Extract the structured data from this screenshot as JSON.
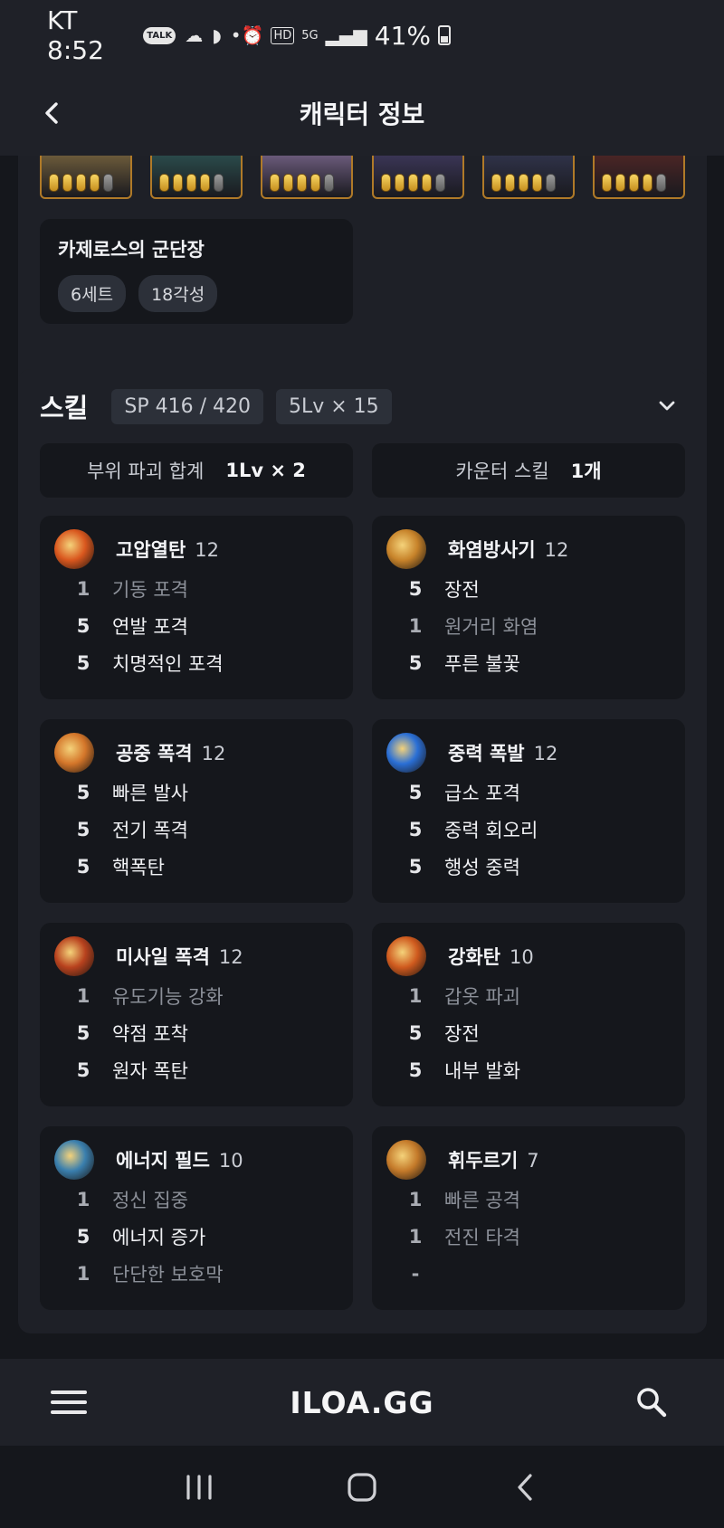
{
  "status_bar": {
    "carrier_time": "KT 8:52",
    "talk_label": "TALK",
    "network": "5G",
    "battery": "41%",
    "hd_label": "HD"
  },
  "header": {
    "title": "캐릭터 정보"
  },
  "engraving_set": {
    "title": "카제로스의 군단장",
    "tags": [
      "6세트",
      "18각성"
    ]
  },
  "portraits": [
    {
      "filled": 4,
      "total": 5,
      "bg": "#6b5a3a"
    },
    {
      "filled": 4,
      "total": 5,
      "bg": "#2a4a4a"
    },
    {
      "filled": 4,
      "total": 5,
      "bg": "#6a5a7a"
    },
    {
      "filled": 4,
      "total": 5,
      "bg": "#3a3555"
    },
    {
      "filled": 4,
      "total": 5,
      "bg": "#2f3248"
    },
    {
      "filled": 4,
      "total": 5,
      "bg": "#4a2525"
    }
  ],
  "skills_section": {
    "title": "스킬",
    "sp": "SP 416 / 420",
    "level_summary": "5Lv × 15",
    "part_break_label": "부위 파괴 합계",
    "part_break_value": "1Lv × 2",
    "counter_label": "카운터 스킬",
    "counter_value": "1개"
  },
  "skills": [
    {
      "name": "고압열탄",
      "level": "12",
      "icon_color": "#d9571e",
      "tripods": [
        {
          "lv": "1",
          "name": "기동 포격",
          "dim": true
        },
        {
          "lv": "5",
          "name": "연발 포격",
          "dim": false
        },
        {
          "lv": "5",
          "name": "치명적인 포격",
          "dim": false
        }
      ]
    },
    {
      "name": "화염방사기",
      "level": "12",
      "icon_color": "#c7832a",
      "tripods": [
        {
          "lv": "5",
          "name": "장전",
          "dim": false
        },
        {
          "lv": "1",
          "name": "원거리 화염",
          "dim": true
        },
        {
          "lv": "5",
          "name": "푸른 불꽃",
          "dim": false
        }
      ]
    },
    {
      "name": "공중 폭격",
      "level": "12",
      "icon_color": "#d4762a",
      "tripods": [
        {
          "lv": "5",
          "name": "빠른 발사",
          "dim": false
        },
        {
          "lv": "5",
          "name": "전기 폭격",
          "dim": false
        },
        {
          "lv": "5",
          "name": "핵폭탄",
          "dim": false
        }
      ]
    },
    {
      "name": "중력 폭발",
      "level": "12",
      "icon_color": "#2a6fd6",
      "tripods": [
        {
          "lv": "5",
          "name": "급소 포격",
          "dim": false
        },
        {
          "lv": "5",
          "name": "중력 회오리",
          "dim": false
        },
        {
          "lv": "5",
          "name": "행성 중력",
          "dim": false
        }
      ]
    },
    {
      "name": "미사일 폭격",
      "level": "12",
      "icon_color": "#b8421e",
      "tripods": [
        {
          "lv": "1",
          "name": "유도기능 강화",
          "dim": true
        },
        {
          "lv": "5",
          "name": "약점 포착",
          "dim": false
        },
        {
          "lv": "5",
          "name": "원자 폭탄",
          "dim": false
        }
      ]
    },
    {
      "name": "강화탄",
      "level": "10",
      "icon_color": "#cf5a1e",
      "tripods": [
        {
          "lv": "1",
          "name": "갑옷 파괴",
          "dim": true
        },
        {
          "lv": "5",
          "name": "장전",
          "dim": false
        },
        {
          "lv": "5",
          "name": "내부 발화",
          "dim": false
        }
      ]
    },
    {
      "name": "에너지 필드",
      "level": "10",
      "icon_color": "#3a7fae",
      "tripods": [
        {
          "lv": "1",
          "name": "정신 집중",
          "dim": true
        },
        {
          "lv": "5",
          "name": "에너지 증가",
          "dim": false
        },
        {
          "lv": "1",
          "name": "단단한 보호막",
          "dim": true
        }
      ]
    },
    {
      "name": "휘두르기",
      "level": "7",
      "icon_color": "#c47a2a",
      "tripods": [
        {
          "lv": "1",
          "name": "빠른 공격",
          "dim": true
        },
        {
          "lv": "1",
          "name": "전진 타격",
          "dim": true
        },
        {
          "lv": "-",
          "name": "",
          "dim": true
        }
      ]
    }
  ],
  "bottom_nav": {
    "logo": "ILOA.GG"
  }
}
